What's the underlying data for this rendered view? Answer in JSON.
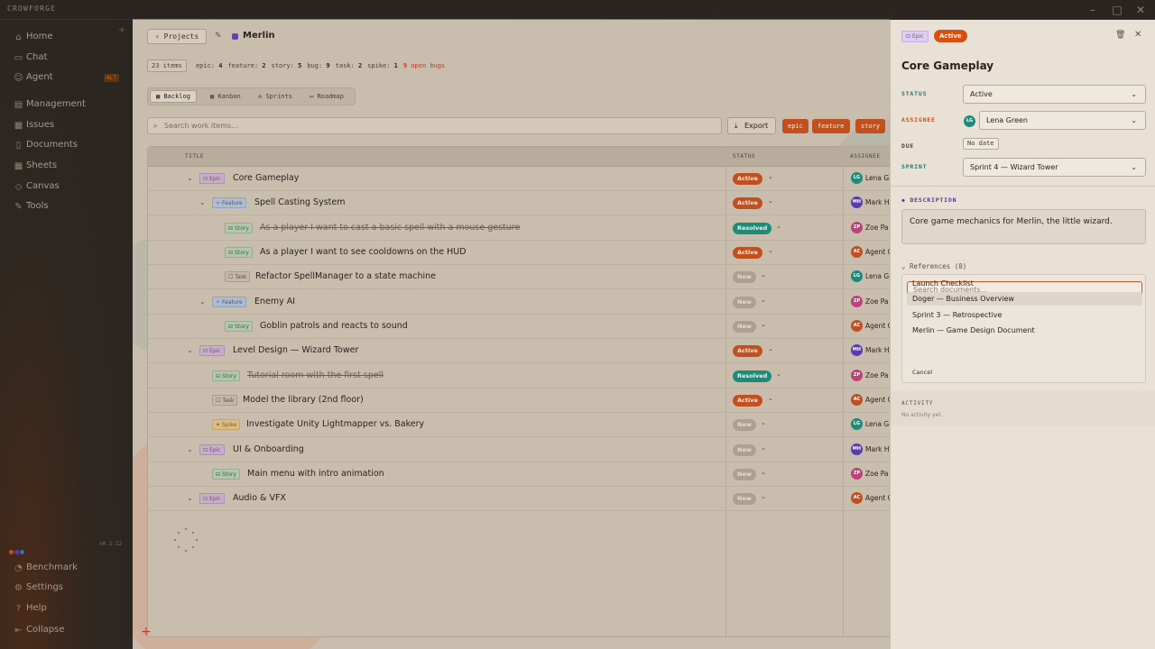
{
  "window": {
    "brand": "CROWFORGE",
    "minimize": "–",
    "maximize": "□",
    "close": "✕"
  },
  "sidebar": {
    "top": [
      {
        "label": "Home",
        "icon": "⌂",
        "iname": "home-icon"
      },
      {
        "label": "Chat",
        "icon": "▭",
        "iname": "chat-icon"
      },
      {
        "label": "Agent",
        "icon": "☺",
        "iname": "agent-icon",
        "badge": "ALT"
      },
      {
        "label": "Management",
        "icon": "▤",
        "iname": "management-icon"
      },
      {
        "label": "Issues",
        "icon": "▦",
        "iname": "issues-icon"
      },
      {
        "label": "Documents",
        "icon": "▯",
        "iname": "documents-icon"
      },
      {
        "label": "Sheets",
        "icon": "▦",
        "iname": "sheets-icon"
      },
      {
        "label": "Canvas",
        "icon": "◇",
        "iname": "canvas-icon"
      },
      {
        "label": "Tools",
        "icon": "✎",
        "iname": "tools-icon"
      }
    ],
    "version": "v0.1.12",
    "bottom": [
      {
        "label": "Benchmark",
        "icon": "◔",
        "iname": "benchmark-icon"
      },
      {
        "label": "Settings",
        "icon": "⚙",
        "iname": "gear-icon"
      },
      {
        "label": "Help",
        "icon": "?",
        "iname": "help-icon"
      },
      {
        "label": "Collapse",
        "icon": "⇤",
        "iname": "collapse-icon"
      }
    ]
  },
  "header": {
    "back_label": "Projects",
    "project": "Merlin"
  },
  "stats": {
    "total": "23 items",
    "items": [
      {
        "k": "epic:",
        "v": "4"
      },
      {
        "k": "feature:",
        "v": "2"
      },
      {
        "k": "story:",
        "v": "5"
      },
      {
        "k": "bug:",
        "v": "9"
      },
      {
        "k": "task:",
        "v": "2"
      },
      {
        "k": "spike:",
        "v": "1"
      }
    ],
    "open_bugs_count": "9",
    "open_bugs_label": "open bugs"
  },
  "views": [
    "Backlog",
    "Kanban",
    "Sprints",
    "Roadmap"
  ],
  "toolbar": {
    "search_placeholder": "Search work items...",
    "export": "Export",
    "filters": [
      "epic",
      "feature",
      "story"
    ]
  },
  "table": {
    "headers": {
      "title": "TITLE",
      "status": "STATUS",
      "assignee": "ASSIGNEE"
    },
    "rows": [
      {
        "level": 0,
        "chev": true,
        "type": "Epic",
        "title": "Core Gameplay",
        "status": "Active",
        "ini": "LG",
        "assignee": "Lena Gr",
        "done": false
      },
      {
        "level": 1,
        "chev": true,
        "type": "Feature",
        "title": "Spell Casting System",
        "status": "Active",
        "ini": "MH",
        "assignee": "Mark H",
        "done": false
      },
      {
        "level": 2,
        "chev": false,
        "type": "Story",
        "title": "As a player I want to cast a basic spell with a mouse gesture",
        "status": "Resolved",
        "ini": "ZP",
        "assignee": "Zoe Pa",
        "done": true
      },
      {
        "level": 2,
        "chev": false,
        "type": "Story",
        "title": "As a player I want to see cooldowns on the HUD",
        "status": "Active",
        "ini": "AC",
        "assignee": "Agent C",
        "done": false
      },
      {
        "level": 2,
        "chev": false,
        "type": "Task",
        "title": "Refactor SpellManager to a state machine",
        "status": "New",
        "ini": "LG",
        "assignee": "Lena Gr",
        "done": false
      },
      {
        "level": 1,
        "chev": true,
        "type": "Feature",
        "title": "Enemy AI",
        "status": "New",
        "ini": "ZP",
        "assignee": "Zoe Pa",
        "done": false
      },
      {
        "level": 2,
        "chev": false,
        "type": "Story",
        "title": "Goblin patrols and reacts to sound",
        "status": "New",
        "ini": "AC",
        "assignee": "Agent C",
        "done": false
      },
      {
        "level": 0,
        "chev": true,
        "type": "Epic",
        "title": "Level Design — Wizard Tower",
        "status": "Active",
        "ini": "MH",
        "assignee": "Mark H",
        "done": false
      },
      {
        "level": 1,
        "chev": false,
        "type": "Story",
        "title": "Tutorial room with the first spell",
        "status": "Resolved",
        "ini": "ZP",
        "assignee": "Zoe Pa",
        "done": true
      },
      {
        "level": 1,
        "chev": false,
        "type": "Task",
        "title": "Model the library (2nd floor)",
        "status": "Active",
        "ini": "AC",
        "assignee": "Agent C",
        "done": false
      },
      {
        "level": 1,
        "chev": false,
        "type": "Spike",
        "title": "Investigate Unity Lightmapper vs. Bakery",
        "status": "New",
        "ini": "LG",
        "assignee": "Lena Gr",
        "done": false
      },
      {
        "level": 0,
        "chev": true,
        "type": "Epic",
        "title": "UI & Onboarding",
        "status": "New",
        "ini": "MH",
        "assignee": "Mark H",
        "done": false
      },
      {
        "level": 1,
        "chev": false,
        "type": "Story",
        "title": "Main menu with intro animation",
        "status": "New",
        "ini": "ZP",
        "assignee": "Zoe Pa",
        "done": false
      },
      {
        "level": 0,
        "chev": true,
        "type": "Epic",
        "title": "Audio & VFX",
        "status": "New",
        "ini": "AC",
        "assignee": "Agent C",
        "done": false
      }
    ]
  },
  "avatar_colors": {
    "LG": "#1f8a7a",
    "MH": "#5a3ab0",
    "ZP": "#c0407a",
    "AC": "#c2501e"
  },
  "detail": {
    "type": "Epic",
    "status_badge": "Active",
    "title": "Core Gameplay",
    "labels": {
      "status": "STATUS",
      "assignee": "ASSIGNEE",
      "due": "DUE",
      "sprint": "SPRINT"
    },
    "status_value": "Active",
    "assignee_initials": "LG",
    "assignee_value": "Lena Green",
    "due_value": "No date",
    "sprint_value": "Sprint 4 — Wizard Tower",
    "description_label": "DESCRIPTION",
    "description": "Core game mechanics for Merlin, the little wizard.",
    "references_label": "References (0)",
    "ref_search_placeholder": "Search documents...",
    "ref_options": [
      "Launch Checklist",
      "Doger — Business Overview",
      "Sprint 3 — Retrospective",
      "Merlin — Game Design Document"
    ],
    "cancel": "Cancel",
    "activity_label": "ACTIVITY",
    "activity_empty": "No activity yet."
  }
}
